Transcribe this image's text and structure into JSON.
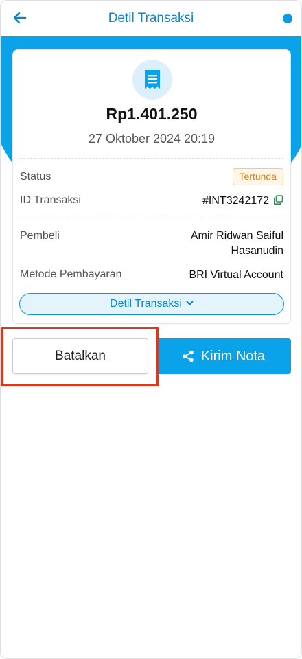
{
  "header": {
    "title": "Detil Transaksi",
    "back_icon": "arrow-left-icon",
    "accent": "#0a86c9"
  },
  "summary": {
    "icon": "receipt-icon",
    "amount": "Rp1.401.250",
    "datetime": "27 Oktober 2024 20:19"
  },
  "details": {
    "status_label": "Status",
    "status_value": "Tertunda",
    "id_label": "ID Transaksi",
    "id_value": "#INT3242172",
    "buyer_label": "Pembeli",
    "buyer_line1": "Amir Ridwan Saiful",
    "buyer_line2": "Hasanudin",
    "method_label": "Metode Pembayaran",
    "method_value": "BRI Virtual Account",
    "detail_button": "Detil Transaksi"
  },
  "actions": {
    "cancel_label": "Batalkan",
    "send_label": "Kirim Nota"
  },
  "colors": {
    "primary": "#0aa3e9",
    "pending_text": "#d9860c",
    "highlight": "#e0361c"
  }
}
